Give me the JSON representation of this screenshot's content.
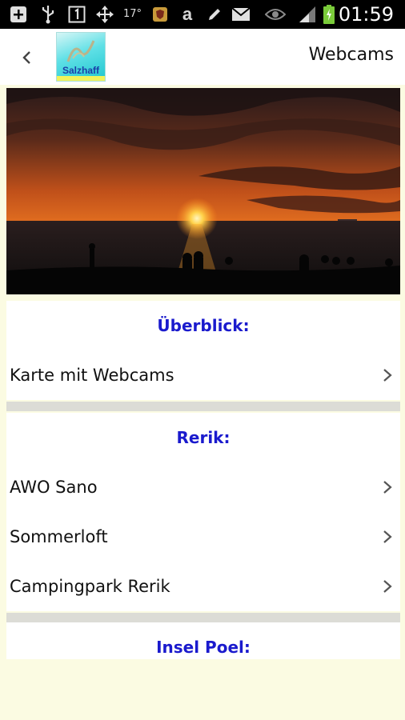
{
  "status_bar": {
    "time": "01:59",
    "temperature": "17°",
    "icons": [
      "add-box-icon",
      "usb-icon",
      "notification-one-icon",
      "move-icon",
      "shield-app-icon",
      "amazon-icon",
      "pen-icon",
      "mail-icon",
      "eye-icon",
      "signal-icon",
      "battery-charging-icon"
    ]
  },
  "app_bar": {
    "logo_text": "Salzhaff",
    "title": "Webcams"
  },
  "sections": [
    {
      "header": "Überblick:",
      "items": [
        "Karte mit Webcams"
      ]
    },
    {
      "header": "Rerik:",
      "items": [
        "AWO Sano",
        "Sommerloft",
        "Campingpark Rerik"
      ]
    },
    {
      "header": "Insel Poel:",
      "items": []
    }
  ],
  "colors": {
    "section_header": "#1A1ACD",
    "page_background": "#FBFBE2",
    "status_bar": "#000000"
  }
}
